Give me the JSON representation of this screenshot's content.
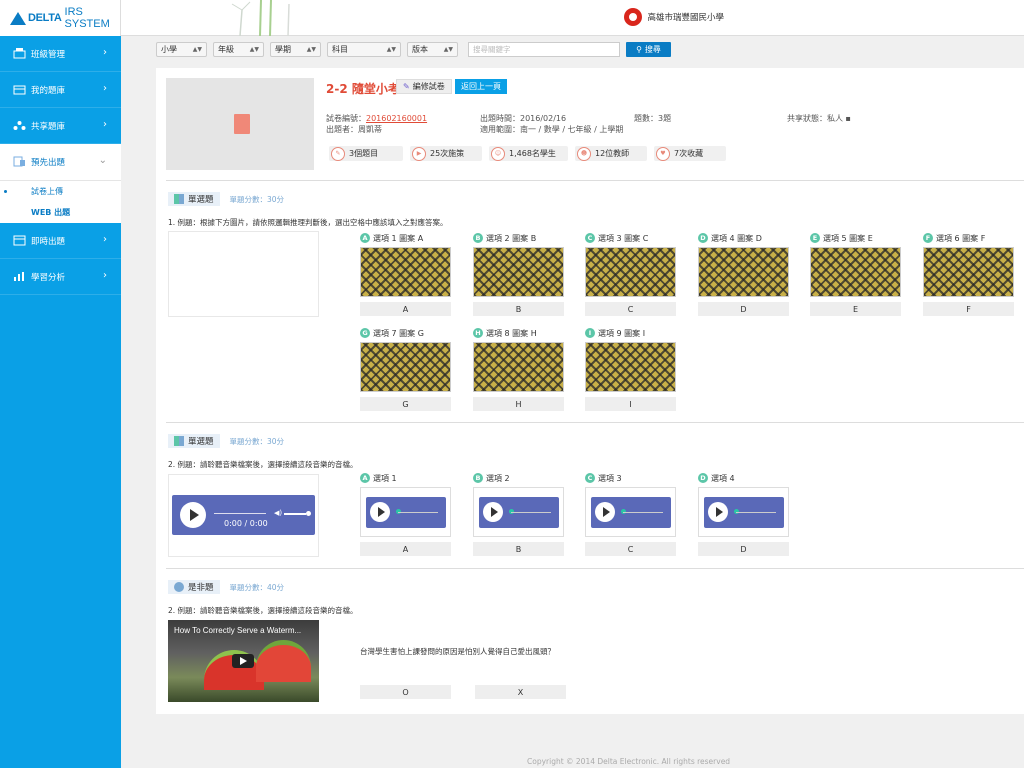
{
  "header": {
    "brand": "DELTA",
    "system": "IRS SYSTEM",
    "school": "高雄市瑞豐國民小學"
  },
  "sidebar": {
    "items": [
      {
        "label": "班級管理",
        "icon": "class-icon"
      },
      {
        "label": "我的題庫",
        "icon": "bank-icon"
      },
      {
        "label": "共享題庫",
        "icon": "share-icon"
      },
      {
        "label": "預先出題",
        "icon": "prepare-icon"
      },
      {
        "label": "即時出題",
        "icon": "realtime-icon"
      },
      {
        "label": "學習分析",
        "icon": "chart-icon"
      }
    ],
    "sub_items": [
      {
        "label": "試卷上傳"
      },
      {
        "label": "WEB 出題"
      }
    ]
  },
  "filters": {
    "level": "小學",
    "grade": "年級",
    "semester": "學期",
    "subject": "科目",
    "version": "版本",
    "search_placeholder": "搜尋關鍵字",
    "search_button": "搜尋"
  },
  "paper": {
    "title": "2-2 隨堂小考",
    "edit_label": "編修試卷",
    "back_label": "返回上一頁",
    "id_label": "試卷編號：",
    "id_value": "201602160001",
    "author_label": "出題者：周凱蒂",
    "time_label": "出題時間：2016/02/16",
    "scope_label": "適用範圍：南一 / 數學 / 七年級 / 上學期",
    "count_label": "題數：3題",
    "share_label": "共享狀態：私人",
    "stats": [
      "3個題目",
      "25次施策",
      "1,468名學生",
      "12位教師",
      "7次收藏"
    ]
  },
  "q1": {
    "type": "單選題",
    "score": "單題分數：30分",
    "text": "1. 例題：根據下方圖片，請依照邏輯推理判斷後，選出空格中應該填入之對應答案。",
    "options": [
      {
        "letter": "A",
        "label": "選項 1 圖案 A",
        "answer": "A"
      },
      {
        "letter": "B",
        "label": "選項 2 圖案 B",
        "answer": "B"
      },
      {
        "letter": "C",
        "label": "選項 3 圖案 C",
        "answer": "C"
      },
      {
        "letter": "D",
        "label": "選項 4 圖案 D",
        "answer": "D"
      },
      {
        "letter": "E",
        "label": "選項 5 圖案 E",
        "answer": "E"
      },
      {
        "letter": "F",
        "label": "選項 6 圖案 F",
        "answer": "F"
      },
      {
        "letter": "G",
        "label": "選項 7 圖案 G",
        "answer": "G"
      },
      {
        "letter": "H",
        "label": "選項 8 圖案 H",
        "answer": "H"
      },
      {
        "letter": "I",
        "label": "選項 9 圖案 I",
        "answer": "I"
      }
    ]
  },
  "q2": {
    "type": "單選題",
    "score": "單題分數：30分",
    "text": "2. 例題：請聆聽音樂檔案後，選擇接續這段音樂的音檔。",
    "player_time": "0:00 / 0:00",
    "options": [
      {
        "letter": "A",
        "label": "選項 1",
        "answer": "A"
      },
      {
        "letter": "B",
        "label": "選項 2",
        "answer": "B"
      },
      {
        "letter": "C",
        "label": "選項 3",
        "answer": "C"
      },
      {
        "letter": "D",
        "label": "選項 4",
        "answer": "D"
      }
    ]
  },
  "q3": {
    "type": "是非題",
    "score": "單題分數：40分",
    "text": "2. 例題：請聆聽音樂檔案後，選擇接續這段音樂的音檔。",
    "video_title": "How To Correctly Serve a Waterm...",
    "question": "台灣學生害怕上課發問的原因是怕別人覺得自己愛出風頭？",
    "answers": [
      "O",
      "X"
    ]
  },
  "footer": {
    "copyright": "Copyright © 2014 Delta Electronic. All rights reserved"
  }
}
